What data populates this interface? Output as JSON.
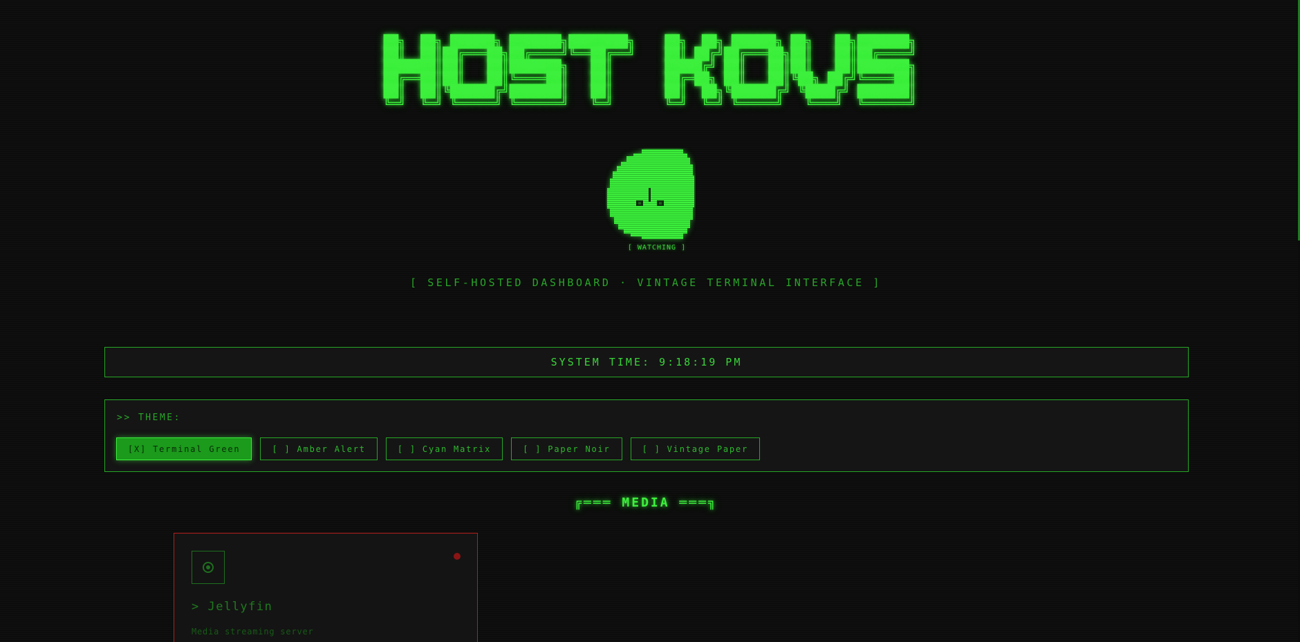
{
  "banner": {
    "ascii": "██╗  ██╗ ██████╗ ███████╗████████╗    ██╗  ██╗ ██████╗ ██╗   ██╗███████╗\n██║  ██║██╔═══██╗██╔════╝╚══██╔══╝    ██║ ██╔╝██╔═══██╗██║   ██║██╔════╝\n███████║██║   ██║███████╗   ██║       █████╔╝ ██║   ██║██║   ██║███████╗\n██╔══██║██║   ██║╚════██║   ██║       ██╔═██╗ ██║   ██║╚██╗ ██╔╝╚════██║\n██║  ██║╚██████╔╝███████║   ██║       ██║  ██╗╚██████╔╝ ╚████╔╝ ███████║\n╚═╝  ╚═╝ ╚═════╝ ╚══════╝   ╚═╝       ╚═╝  ╚═╝ ╚═════╝   ╚═══╝  ╚══════╝"
  },
  "mascot": {
    "caption": "[ WATCHING ]"
  },
  "tagline": "[ SELF-HOSTED DASHBOARD · VINTAGE TERMINAL INTERFACE ]",
  "system_time": {
    "text": "SYSTEM TIME: 9:18:19 PM"
  },
  "theme": {
    "label": ">> THEME:",
    "options": [
      {
        "label": "[X] Terminal Green",
        "active": true
      },
      {
        "label": "[ ] Amber Alert",
        "active": false
      },
      {
        "label": "[ ] Cyan Matrix",
        "active": false
      },
      {
        "label": "[ ] Paper Noir",
        "active": false
      },
      {
        "label": "[ ] Vintage Paper",
        "active": false
      }
    ]
  },
  "section": {
    "heading": "╔═══ MEDIA ═══╗"
  },
  "services": [
    {
      "title": "> Jellyfin",
      "description": "Media streaming server",
      "status_color": "#8a1414",
      "icon": "jellyfin-icon"
    }
  ],
  "colors": {
    "accent": "#3df03d",
    "background": "#0b0c0b",
    "panel": "#151515",
    "offline": "#b81d1d"
  }
}
